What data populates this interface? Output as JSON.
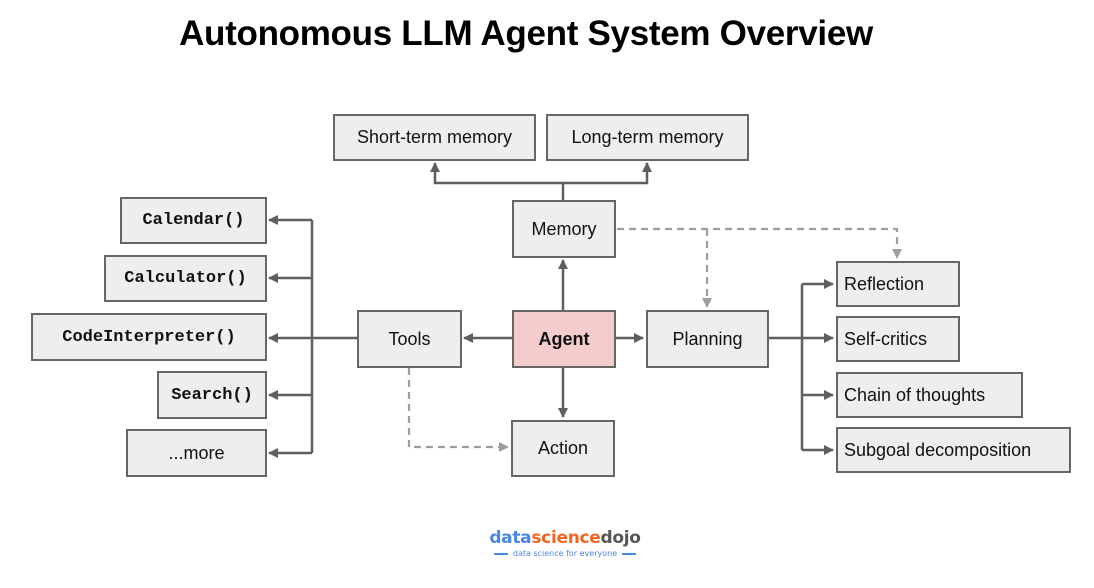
{
  "title": "Autonomous LLM Agent System Overview",
  "nodes": {
    "short_term_memory": "Short-term memory",
    "long_term_memory": "Long-term memory",
    "memory": "Memory",
    "agent": "Agent",
    "tools": "Tools",
    "planning": "Planning",
    "action": "Action",
    "tool_calendar": "Calendar()",
    "tool_calculator": "Calculator()",
    "tool_code_interpreter": "CodeInterpreter()",
    "tool_search": "Search()",
    "tool_more": "...more",
    "reflection": "Reflection",
    "self_critics": "Self-critics",
    "chain_of_thoughts": "Chain of thoughts",
    "subgoal_decomposition": "Subgoal decomposition"
  },
  "edges": [
    {
      "from": "agent",
      "to": "memory",
      "style": "solid"
    },
    {
      "from": "agent",
      "to": "tools",
      "style": "solid"
    },
    {
      "from": "agent",
      "to": "planning",
      "style": "solid"
    },
    {
      "from": "agent",
      "to": "action",
      "style": "solid"
    },
    {
      "from": "memory",
      "to": "short_term_memory",
      "style": "solid"
    },
    {
      "from": "memory",
      "to": "long_term_memory",
      "style": "solid"
    },
    {
      "from": "memory",
      "to": "planning",
      "style": "dashed"
    },
    {
      "from": "memory",
      "to": "reflection",
      "style": "dashed"
    },
    {
      "from": "tools",
      "to": "action",
      "style": "dashed"
    },
    {
      "from": "tools",
      "to": "tool_calendar",
      "style": "solid"
    },
    {
      "from": "tools",
      "to": "tool_calculator",
      "style": "solid"
    },
    {
      "from": "tools",
      "to": "tool_code_interpreter",
      "style": "solid"
    },
    {
      "from": "tools",
      "to": "tool_search",
      "style": "solid"
    },
    {
      "from": "tools",
      "to": "tool_more",
      "style": "solid"
    },
    {
      "from": "planning",
      "to": "reflection",
      "style": "solid"
    },
    {
      "from": "planning",
      "to": "self_critics",
      "style": "solid"
    },
    {
      "from": "planning",
      "to": "chain_of_thoughts",
      "style": "solid"
    },
    {
      "from": "planning",
      "to": "subgoal_decomposition",
      "style": "solid"
    }
  ],
  "colors": {
    "node_fill": "#eeeeee",
    "agent_fill": "#f4cccc",
    "border": "#666666",
    "solid_edge": "#5f5f5f",
    "dashed_edge": "#9e9e9e"
  },
  "logo": {
    "part1": "data",
    "part2": "science",
    "part3": "dojo",
    "tagline": "data science for everyone"
  }
}
